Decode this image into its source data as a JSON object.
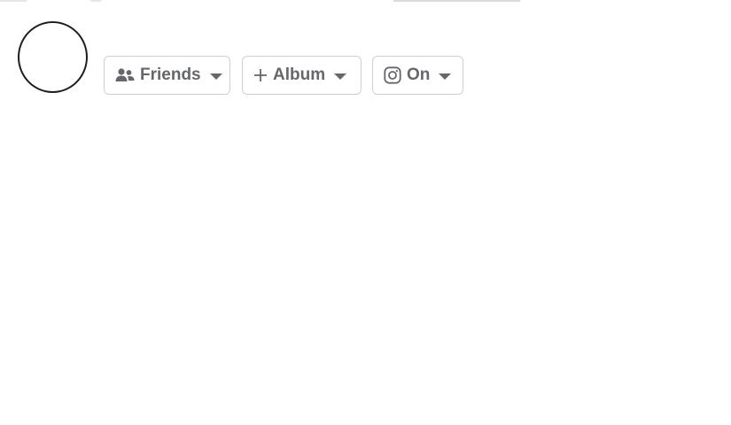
{
  "composer": {
    "audience_button": {
      "label": "Friends",
      "icon": "friends-icon"
    },
    "album_button": {
      "label": "Album",
      "icon": "plus-icon"
    },
    "instagram_button": {
      "label": "On",
      "icon": "instagram-icon"
    }
  },
  "colors": {
    "chip_text": "#65676b",
    "chip_border": "#ccd0d5",
    "avatar_outline": "#1c1e21"
  }
}
